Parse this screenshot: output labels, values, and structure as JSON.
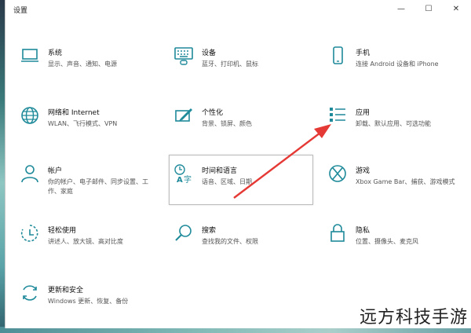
{
  "window": {
    "title": "设置",
    "minimize": "—",
    "maximize": "☐",
    "close": "✕"
  },
  "tiles": [
    {
      "title": "系统",
      "desc": "显示、声音、通知、电源",
      "icon": "laptop-icon"
    },
    {
      "title": "设备",
      "desc": "蓝牙、打印机、鼠标",
      "icon": "keyboard-icon"
    },
    {
      "title": "手机",
      "desc": "连接 Android 设备和 iPhone",
      "icon": "phone-icon"
    },
    {
      "title": "网络和 Internet",
      "desc": "WLAN、飞行模式、VPN",
      "icon": "globe-icon"
    },
    {
      "title": "个性化",
      "desc": "背景、锁屏、颜色",
      "icon": "paint-icon"
    },
    {
      "title": "应用",
      "desc": "卸载、默认应用、可选功能",
      "icon": "apps-list-icon"
    },
    {
      "title": "帐户",
      "desc": "你的帐户、电子邮件、同步设置、工作、家庭",
      "icon": "person-icon"
    },
    {
      "title": "时间和语言",
      "desc": "语音、区域、日期",
      "icon": "time-language-icon"
    },
    {
      "title": "游戏",
      "desc": "Xbox Game Bar、捕获、游戏模式",
      "icon": "xbox-icon"
    },
    {
      "title": "轻松使用",
      "desc": "讲述人、放大镜、高对比度",
      "icon": "ease-of-access-icon"
    },
    {
      "title": "搜索",
      "desc": "查找我的文件、权限",
      "icon": "search-icon"
    },
    {
      "title": "隐私",
      "desc": "位置、摄像头、麦克风",
      "icon": "lock-icon"
    },
    {
      "title": "更新和安全",
      "desc": "Windows 更新、恢复、备份",
      "icon": "update-icon"
    }
  ],
  "watermark": "远方科技手游",
  "colors": {
    "accent": "#1e8a9a",
    "arrow": "#e53935"
  }
}
